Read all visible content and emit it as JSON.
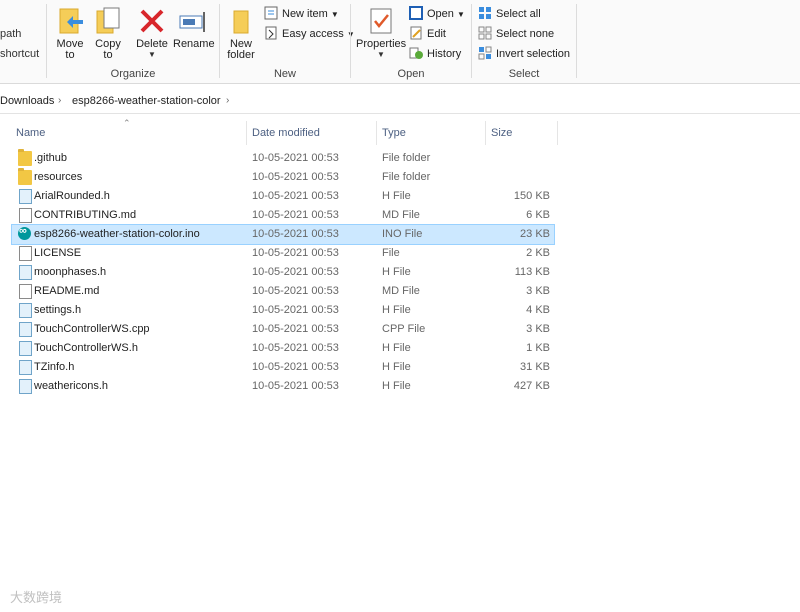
{
  "ribbon": {
    "clipboard_cut": {
      "path_text": "path",
      "shortcut_text": "shortcut"
    },
    "organize": {
      "label": "Organize",
      "move": {
        "line1": "Move",
        "line2": "to"
      },
      "copy": {
        "line1": "Copy",
        "line2": "to"
      },
      "delete": {
        "line1": "Delete"
      },
      "rename": {
        "line1": "Rename"
      }
    },
    "new": {
      "label": "New",
      "new_folder": {
        "line1": "New",
        "line2": "folder"
      },
      "new_item": "New item",
      "easy_access": "Easy access"
    },
    "open": {
      "label": "Open",
      "properties": "Properties",
      "open": "Open",
      "edit": "Edit",
      "history": "History"
    },
    "select": {
      "label": "Select",
      "select_all": "Select all",
      "select_none": "Select none",
      "invert": "Invert selection"
    }
  },
  "breadcrumb": {
    "seg1": "Downloads",
    "seg2": "esp8266-weather-station-color",
    "sep": "›"
  },
  "columns": {
    "name": "Name",
    "date": "Date modified",
    "type": "Type",
    "size": "Size"
  },
  "files": [
    {
      "name": ".github",
      "date": "10-05-2021 00:53",
      "type": "File folder",
      "size": "",
      "icon": "folder"
    },
    {
      "name": "resources",
      "date": "10-05-2021 00:53",
      "type": "File folder",
      "size": "",
      "icon": "folder"
    },
    {
      "name": "ArialRounded.h",
      "date": "10-05-2021 00:53",
      "type": "H File",
      "size": "150 KB",
      "icon": "hdoc"
    },
    {
      "name": "CONTRIBUTING.md",
      "date": "10-05-2021 00:53",
      "type": "MD File",
      "size": "6 KB",
      "icon": "doc"
    },
    {
      "name": "esp8266-weather-station-color.ino",
      "date": "10-05-2021 00:53",
      "type": "INO File",
      "size": "23 KB",
      "icon": "ino"
    },
    {
      "name": "LICENSE",
      "date": "10-05-2021 00:53",
      "type": "File",
      "size": "2 KB",
      "icon": "doc"
    },
    {
      "name": "moonphases.h",
      "date": "10-05-2021 00:53",
      "type": "H File",
      "size": "113 KB",
      "icon": "hdoc"
    },
    {
      "name": "README.md",
      "date": "10-05-2021 00:53",
      "type": "MD File",
      "size": "3 KB",
      "icon": "doc"
    },
    {
      "name": "settings.h",
      "date": "10-05-2021 00:53",
      "type": "H File",
      "size": "4 KB",
      "icon": "hdoc"
    },
    {
      "name": "TouchControllerWS.cpp",
      "date": "10-05-2021 00:53",
      "type": "CPP File",
      "size": "3 KB",
      "icon": "hdoc"
    },
    {
      "name": "TouchControllerWS.h",
      "date": "10-05-2021 00:53",
      "type": "H File",
      "size": "1 KB",
      "icon": "hdoc"
    },
    {
      "name": "TZinfo.h",
      "date": "10-05-2021 00:53",
      "type": "H File",
      "size": "31 KB",
      "icon": "hdoc"
    },
    {
      "name": "weathericons.h",
      "date": "10-05-2021 00:53",
      "type": "H File",
      "size": "427 KB",
      "icon": "hdoc"
    }
  ],
  "selected_index": 4,
  "watermark": "大数跨境"
}
